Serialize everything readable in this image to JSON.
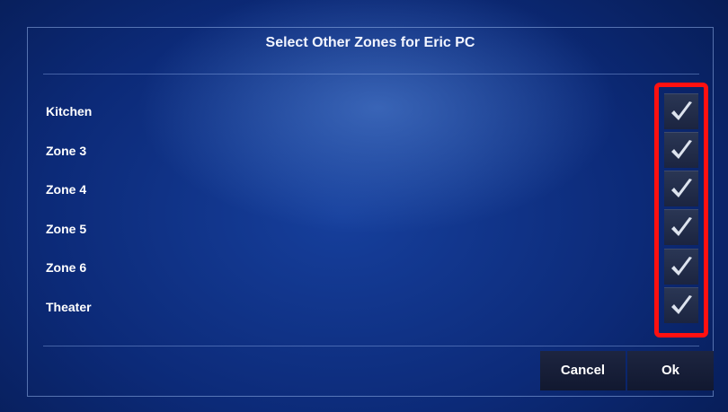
{
  "dialog": {
    "title": "Select Other Zones for Eric PC"
  },
  "zones": [
    {
      "label": "Kitchen",
      "checked": true
    },
    {
      "label": "Zone 3",
      "checked": true
    },
    {
      "label": "Zone 4",
      "checked": true
    },
    {
      "label": "Zone 5",
      "checked": true
    },
    {
      "label": "Zone 6",
      "checked": true
    },
    {
      "label": "Theater",
      "checked": true
    }
  ],
  "icons": {
    "checkbox": "checkmark-icon"
  },
  "buttons": {
    "cancel_label": "Cancel",
    "ok_label": "Ok"
  },
  "colors": {
    "highlight": "#ff1010",
    "background": "#0c2a78"
  }
}
